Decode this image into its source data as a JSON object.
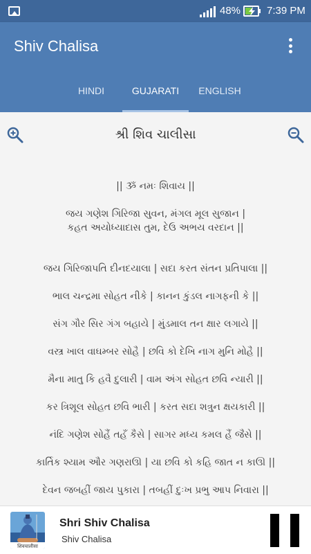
{
  "status": {
    "battery_percent": "48%",
    "time": "7:39 PM",
    "icons": [
      "gallery-icon",
      "signal-icon",
      "battery-charging-icon"
    ]
  },
  "app": {
    "title": "Shiv Chalisa",
    "menu_icon": "more-vert-icon"
  },
  "tabs": [
    {
      "label": "HINDI",
      "active": false
    },
    {
      "label": "GUJARATI",
      "active": true
    },
    {
      "label": "ENGLISH",
      "active": false
    }
  ],
  "content": {
    "title": "શ્રી શિવ ચાલીસા",
    "zoom_in_icon": "zoom-in-icon",
    "zoom_out_icon": "zoom-out-icon",
    "verses": [
      [
        "|| ૐ નમઃ શિવાય ||"
      ],
      [
        "જય ગણેશ ગિરિજા સુવન, મંગલ મૂલ સુજાન |",
        "કહત અયોધ્યાદાસ તુમ, દેઉ અભય વરદાન ||"
      ],
      [
        "જય ગિરિજાપતિ દીનદયાલા | સદા કરત સંતન પ્રતિપાલા ||"
      ],
      [
        "ભાલ ચન્દ્રમા સોહત નીકે | કાનન કુંડલ નાગફની કે ||"
      ],
      [
        "સંગ ગૌર સિર ગંગ બહાયે | મુંડમાલ તન ક્ષાર લગાયે ||"
      ],
      [
        "વસ્ત્ર ખાલ વાઘમ્બર સોહૈ | છવિ કો દેખિ નાગ મુનિ મોહૈ ||"
      ],
      [
        "મૈના માતુ કિ હવૈ દુલારી | વામ અંગ સોહત છવિ ન્યારી ||"
      ],
      [
        "કર ત્રિશૂલ સોહત છવિ ભારી | કરત સદા શત્રુન ક્ષયકારી ||"
      ],
      [
        "નંદિ ગણેશ સોહૈં તહઁ કૈસે | સાગર મધ્ય કમલ હૈં જૈસે ||"
      ],
      [
        "કાર્તિક શ્યામ ઔર ગણરાઊ | યા છવિ કો કહિ જાત ન કાઊ ||"
      ],
      [
        "દેવન જબહીં જાય પુકારા | તબહીં દુઃખ પ્રભુ આપ નિવારા ||"
      ]
    ]
  },
  "player": {
    "album_caption": "शिवचालीसा",
    "track_title": "Shri Shiv Chalisa",
    "track_subtitle": "Shiv Chalisa",
    "pause_icon": "pause-icon"
  }
}
